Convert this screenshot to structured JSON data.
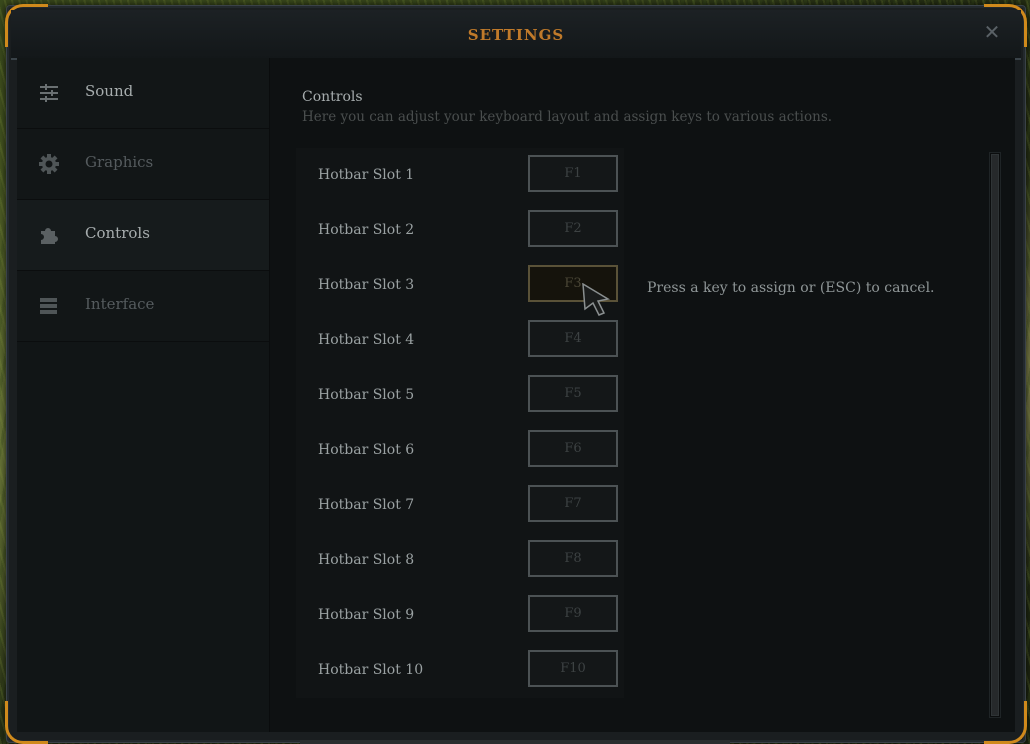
{
  "window": {
    "title": "SETTINGS",
    "close_icon": "close-icon",
    "accent_color": "#c07a2a"
  },
  "sidebar": {
    "items": [
      {
        "label": "Sound",
        "icon": "sliders-icon",
        "active": false
      },
      {
        "label": "Graphics",
        "icon": "gear-icon",
        "active": false
      },
      {
        "label": "Controls",
        "icon": "puzzle-icon",
        "active": true
      },
      {
        "label": "Interface",
        "icon": "list-icon",
        "active": false
      }
    ]
  },
  "content": {
    "title": "Controls",
    "description": "Here you can adjust your keyboard layout and assign keys to various actions.",
    "prompt": "Press a key to assign or (ESC) to cancel.",
    "bindings": [
      {
        "label": "Hotbar Slot 1",
        "key": "F1"
      },
      {
        "label": "Hotbar Slot 2",
        "key": "F2"
      },
      {
        "label": "Hotbar Slot 3",
        "key": "F3",
        "listening": true
      },
      {
        "label": "Hotbar Slot 4",
        "key": "F4"
      },
      {
        "label": "Hotbar Slot 5",
        "key": "F5"
      },
      {
        "label": "Hotbar Slot 6",
        "key": "F6"
      },
      {
        "label": "Hotbar Slot 7",
        "key": "F7"
      },
      {
        "label": "Hotbar Slot 8",
        "key": "F8"
      },
      {
        "label": "Hotbar Slot 9",
        "key": "F9"
      },
      {
        "label": "Hotbar Slot 10",
        "key": "F10"
      }
    ]
  }
}
